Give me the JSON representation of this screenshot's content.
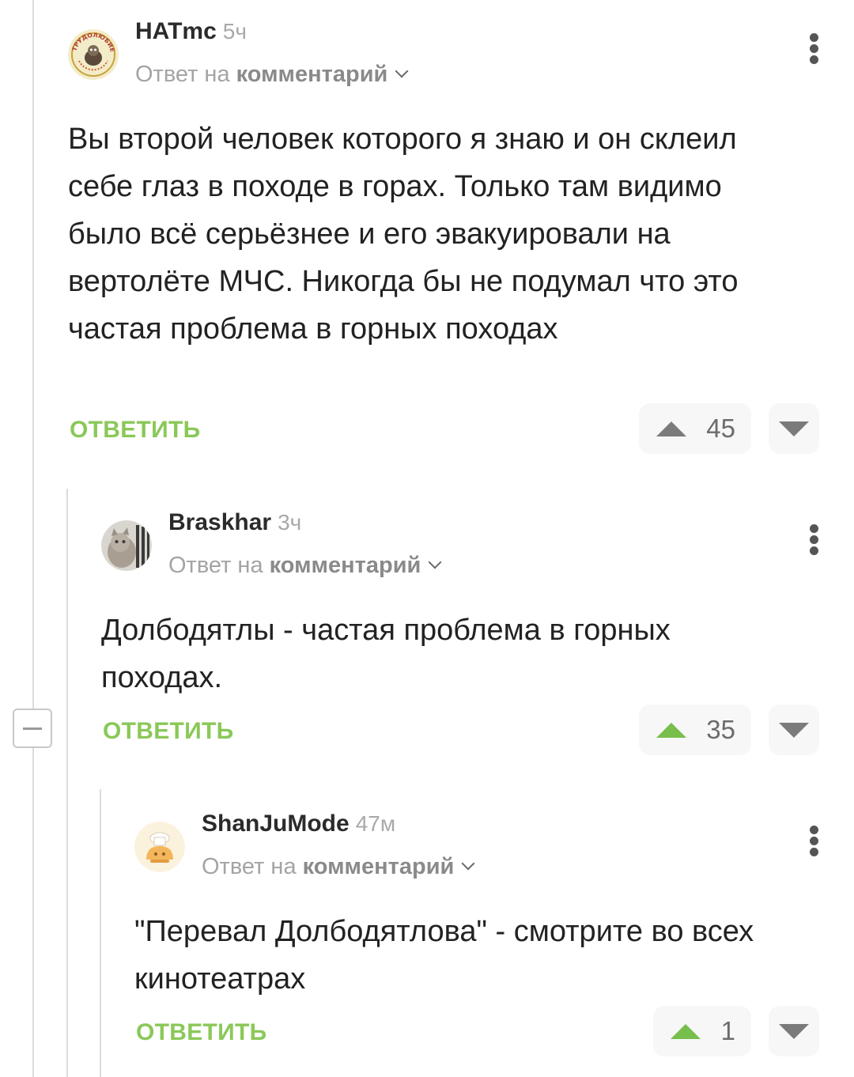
{
  "comments": [
    {
      "author": "HATmc",
      "time": "5ч",
      "reply_prefix": "Ответ на",
      "reply_target": "комментарий",
      "text": "Вы второй человек которого я знаю и он склеил себе глаз в походе в горах. Только там видимо было всё серьёзнее и его эвакуировали на вертолёте МЧС. Никогда бы не подумал что это частая проблема в горных походах",
      "reply_label": "ОТВЕТИТЬ",
      "rating": "45",
      "avatar_text": "ТРУДОЛЮБИЕ"
    },
    {
      "author": "Braskhar",
      "time": "3ч",
      "reply_prefix": "Ответ на",
      "reply_target": "комментарий",
      "text": "Долбодятлы - частая проблема в горных походах.",
      "reply_label": "ОТВЕТИТЬ",
      "rating": "35"
    },
    {
      "author": "ShanJuMode",
      "time": "47м",
      "reply_prefix": "Ответ на",
      "reply_target": "комментарий",
      "text": "\"Перевал Долбодятлова\" - смотрите во всех кинотеатрах",
      "reply_label": "ОТВЕТИТЬ",
      "rating": "1"
    }
  ],
  "icons": {
    "menu": "more-vertical-icon",
    "upvote": "triangle-up-icon",
    "downvote": "triangle-down-icon",
    "collapse": "minus-icon",
    "chevron": "chevron-down-icon"
  },
  "colors": {
    "accent_green": "#8ac858",
    "upvote_active": "#78be4c"
  }
}
